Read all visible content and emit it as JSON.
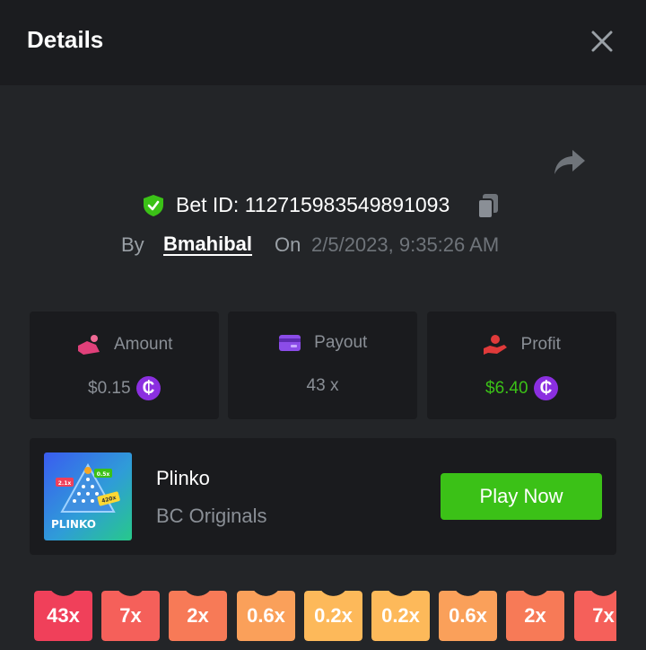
{
  "header": {
    "title": "Details"
  },
  "bet": {
    "id_text": "Bet ID: 112715983549891093",
    "by_label": "By",
    "username": "Bmahibal",
    "on_label": "On",
    "datetime": "2/5/2023, 9:35:26 AM"
  },
  "stats": {
    "amount": {
      "label": "Amount",
      "value": "$0.15"
    },
    "payout": {
      "label": "Payout",
      "value": "43 x"
    },
    "profit": {
      "label": "Profit",
      "value": "$6.40"
    },
    "coin_symbol": "₵"
  },
  "game": {
    "name": "Plinko",
    "provider": "BC Originals",
    "play_label": "Play Now",
    "thumbnail_text": "PLINKO",
    "thumbnail_badges": [
      "2.1x",
      "0.5x",
      "420x"
    ]
  },
  "multipliers": [
    "43x",
    "7x",
    "2x",
    "0.6x",
    "0.2x",
    "0.2x",
    "0.6x",
    "2x",
    "7x"
  ],
  "colors": {
    "accent_green": "#3bc117",
    "coin_purple": "#8b2fe0",
    "multiplier_colors": [
      "#f0405a",
      "#f5605a",
      "#f77a57",
      "#faa05a",
      "#fdb95a",
      "#fdb95a",
      "#faa05a",
      "#f77a57",
      "#f5605a"
    ]
  },
  "icons": {
    "close": "close-icon",
    "share": "share-icon",
    "verified": "shield-check-icon",
    "copy": "copy-icon",
    "amount": "amount-icon",
    "payout": "card-icon",
    "profit": "hand-coin-icon"
  }
}
